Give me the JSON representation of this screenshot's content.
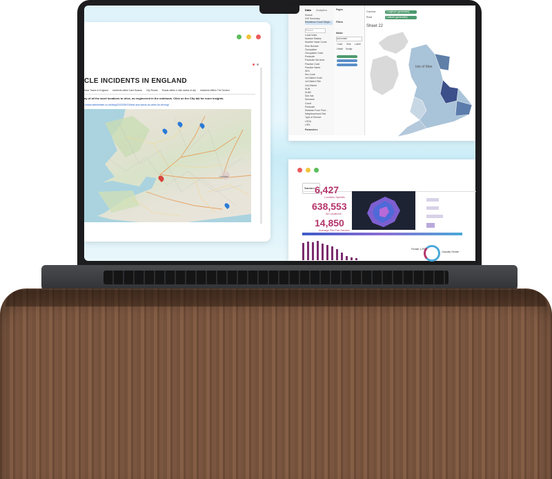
{
  "left_window": {
    "title": "CLE INCIDENTS IN ENGLAND",
    "tabs": [
      "Near Towns in England",
      "Incidents within Care Boards",
      "City Roads",
      "Roads within 4 mile radius of city",
      "Incidents Within The Service"
    ],
    "description": "ay of all the word locations to drive, as engineered in the notebook. Click on the City tab for more insights.",
    "link": "://www.webweltsel.co.uk/blog/2022/06/13/best-and-worst-uk-cities-for-driving/"
  },
  "tableau_window": {
    "data_tab": "Data",
    "analytics_tab": "Analytics",
    "pages_label": "Pages",
    "filters_label": "Filters",
    "marks_label": "Marks",
    "marks_type": "Automatic",
    "mark_buttons": [
      "Color",
      "Size",
      "Label",
      "Detail",
      "Tooltip"
    ],
    "columns_label": "Columns",
    "rows_label": "Rows",
    "columns_pill": "Longitude (generated)",
    "rows_pill": "Latitude (generated)",
    "sheet_title": "Sheet 22",
    "map_label": "Isle of Man",
    "parameters_label": "Parameters",
    "search_placeholder": "Search",
    "fields": [
      "Local Index",
      "Number Radius",
      "Number Value Count",
      "Row Number",
      "Occupation",
      "Occupation Code",
      "Postcode",
      "Postcode Set Area",
      "Practice Code",
      "Practice Name",
      "SEX",
      "Sex Code",
      "1st District Code",
      "1st District Title",
      "2nd District",
      "SUB",
      "SUB2",
      "Sub Inst",
      "Surname",
      "Count",
      "Postcode",
      "Distance From Post...",
      "Neighbourhood Dist",
      "Type of Service",
      "LSOA",
      "LSPL",
      "MeAnimal",
      "Value of Building",
      "POPULATION_SE_E..."
    ],
    "parameter_items": [
      "Deprivation Severity",
      "Mortality Type"
    ],
    "datasource_items": [
      "Source",
      "IOD Summary",
      "Residence Count Neigh..."
    ]
  },
  "dashboard_window": {
    "filter_label": "Standard",
    "stats": [
      {
        "value": "6,427",
        "label": "Location Specific"
      },
      {
        "value": "638,553",
        "label": "All Locations"
      },
      {
        "value": "14,850",
        "label": "Average Per Fire Service"
      }
    ],
    "bar_values": [
      46,
      50,
      48,
      52,
      44,
      40,
      38,
      30,
      20,
      12,
      8,
      6
    ],
    "donut_labels": {
      "left": "Female 1,291",
      "right": "Casualty Gender"
    },
    "hbar_labels": [
      "Male",
      "Female",
      "1000",
      "2000",
      "3000",
      "4000"
    ]
  },
  "colors": {
    "accent": "#b3346a",
    "tableau_green": "#4e9a6e",
    "map_fill": "#6f88b0",
    "dot_green": "#5bbd5a",
    "dot_yellow": "#f2c43d",
    "dot_red": "#ea5b5b"
  }
}
